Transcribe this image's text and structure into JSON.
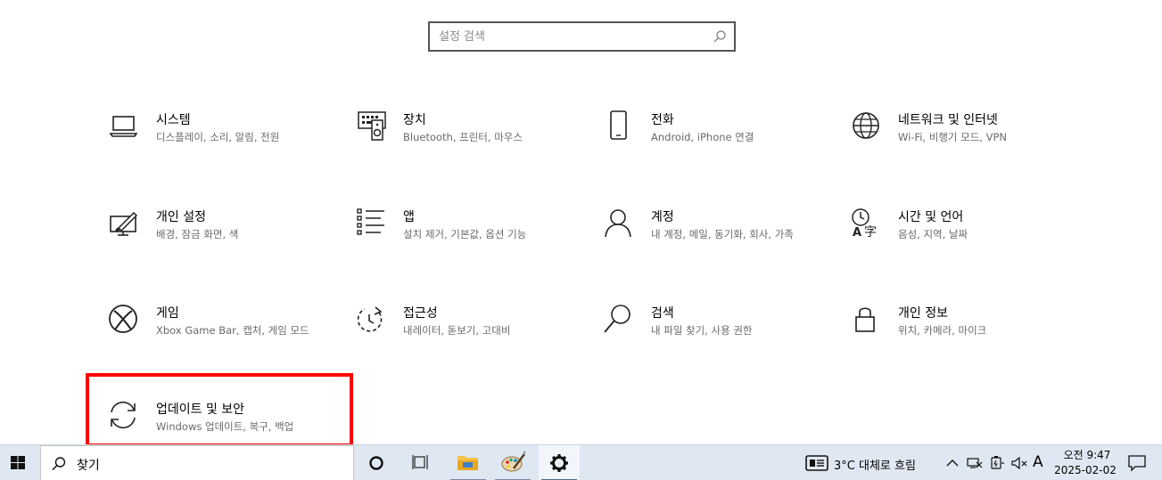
{
  "search": {
    "placeholder": "설정 검색",
    "value": "",
    "icon": "search-icon"
  },
  "tiles": [
    {
      "title": "시스템",
      "desc": "디스플레이, 소리, 알림, 전원",
      "icon": "laptop-icon"
    },
    {
      "title": "장치",
      "desc": "Bluetooth, 프린터, 마우스",
      "icon": "keyboard-speaker-icon"
    },
    {
      "title": "전화",
      "desc": "Android, iPhone 연결",
      "icon": "phone-icon"
    },
    {
      "title": "네트워크 및 인터넷",
      "desc": "Wi-Fi, 비행기 모드, VPN",
      "icon": "globe-icon"
    },
    {
      "title": "개인 설정",
      "desc": "배경, 잠금 화면, 색",
      "icon": "paint-monitor-icon"
    },
    {
      "title": "앱",
      "desc": "설치 제거, 기본값, 옵션 기능",
      "icon": "app-list-icon"
    },
    {
      "title": "계정",
      "desc": "내 계정, 메일, 동기화, 회사, 가족",
      "icon": "person-icon"
    },
    {
      "title": "시간 및 언어",
      "desc": "음성, 지역, 날짜",
      "icon": "time-language-icon"
    },
    {
      "title": "게임",
      "desc": "Xbox Game Bar, 캡처, 게임 모드",
      "icon": "xbox-icon"
    },
    {
      "title": "접근성",
      "desc": "내레이터, 돋보기, 고대비",
      "icon": "accessibility-icon"
    },
    {
      "title": "검색",
      "desc": "내 파일 찾기, 사용 권한",
      "icon": "magnifier-icon"
    },
    {
      "title": "개인 정보",
      "desc": "위치, 카메라, 마이크",
      "icon": "lock-icon"
    },
    {
      "title": "업데이트 및 보안",
      "desc": "Windows 업데이트, 복구, 백업",
      "icon": "sync-icon"
    }
  ],
  "taskbar": {
    "search_text": "찾기",
    "weather": "3°C  대체로 흐림",
    "language": "A",
    "time": "오전 9:47",
    "date": "2025-02-02",
    "accent": "#dfe8f2"
  },
  "highlight_color": "#ff0000"
}
